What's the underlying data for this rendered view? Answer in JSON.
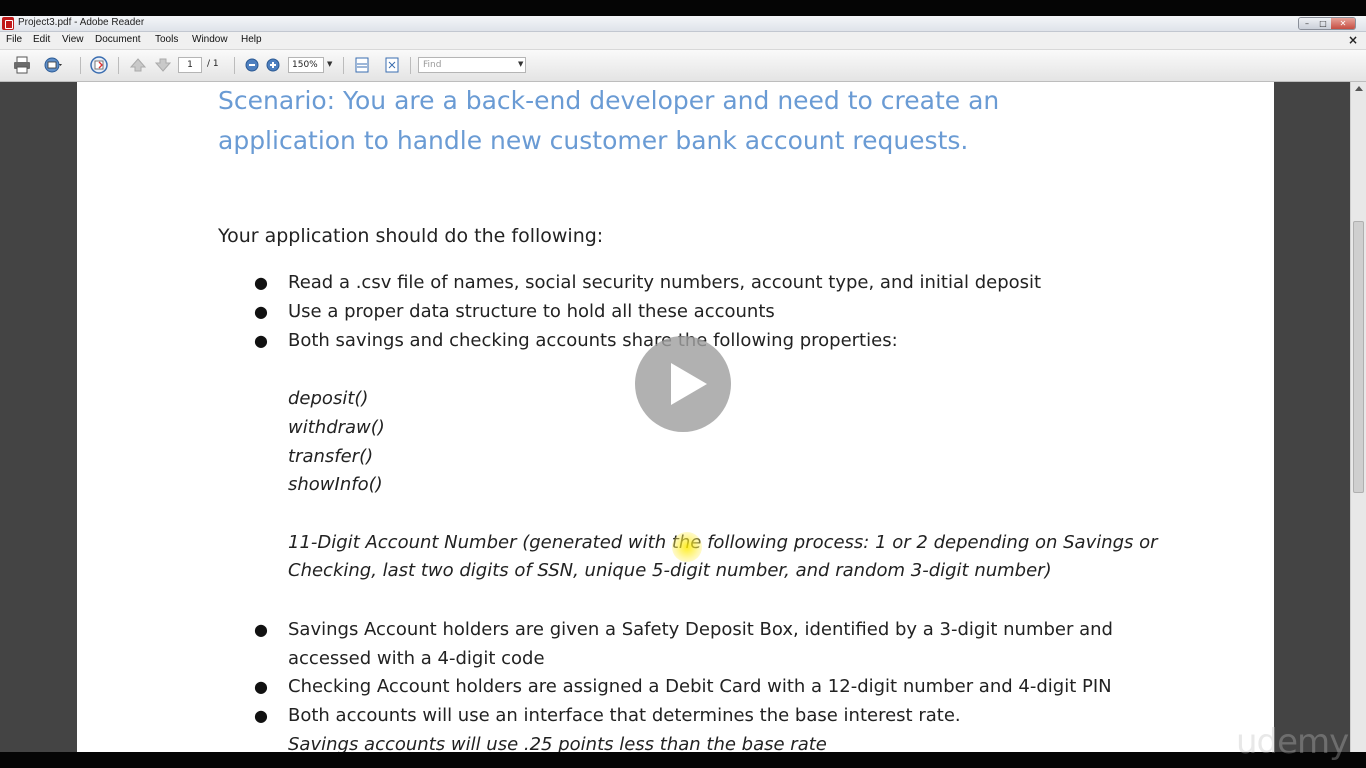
{
  "window": {
    "title": "Project3.pdf - Adobe Reader"
  },
  "menu": [
    "File",
    "Edit",
    "View",
    "Document",
    "Tools",
    "Window",
    "Help"
  ],
  "toolbar": {
    "page_current": "1",
    "page_total": "/ 1",
    "zoom": "150%",
    "find_placeholder": "Find"
  },
  "document": {
    "scenario_line1": "Scenario: You are a back-end developer and need to create an",
    "scenario_line2": "application to handle new customer bank account requests.",
    "intro": "Your application should do the following:",
    "bullets_top": [
      "Read a .csv file of names, social security numbers, account type, and initial deposit",
      "Use a proper data structure to hold all these accounts",
      "Both savings and checking accounts share the following properties:"
    ],
    "methods": [
      "deposit()",
      "withdraw()",
      "transfer()",
      "showInfo()"
    ],
    "account_number_line1": "11-Digit Account Number (generated with the following process: 1 or 2 depending on Savings or",
    "account_number_line2": "Checking, last two digits of SSN, unique 5-digit number, and random 3-digit number)",
    "bullets_bottom": [
      "Savings Account holders are given a Safety Deposit Box, identified by a 3-digit number and",
      "accessed with a 4-digit code",
      "Checking Account holders are assigned a Debit Card with a 12-digit number and 4-digit PIN",
      "Both accounts will use an interface that determines the base interest rate."
    ],
    "savings_rate_line": "Savings accounts will use .25 points less than the base rate"
  },
  "watermark": "udemy"
}
